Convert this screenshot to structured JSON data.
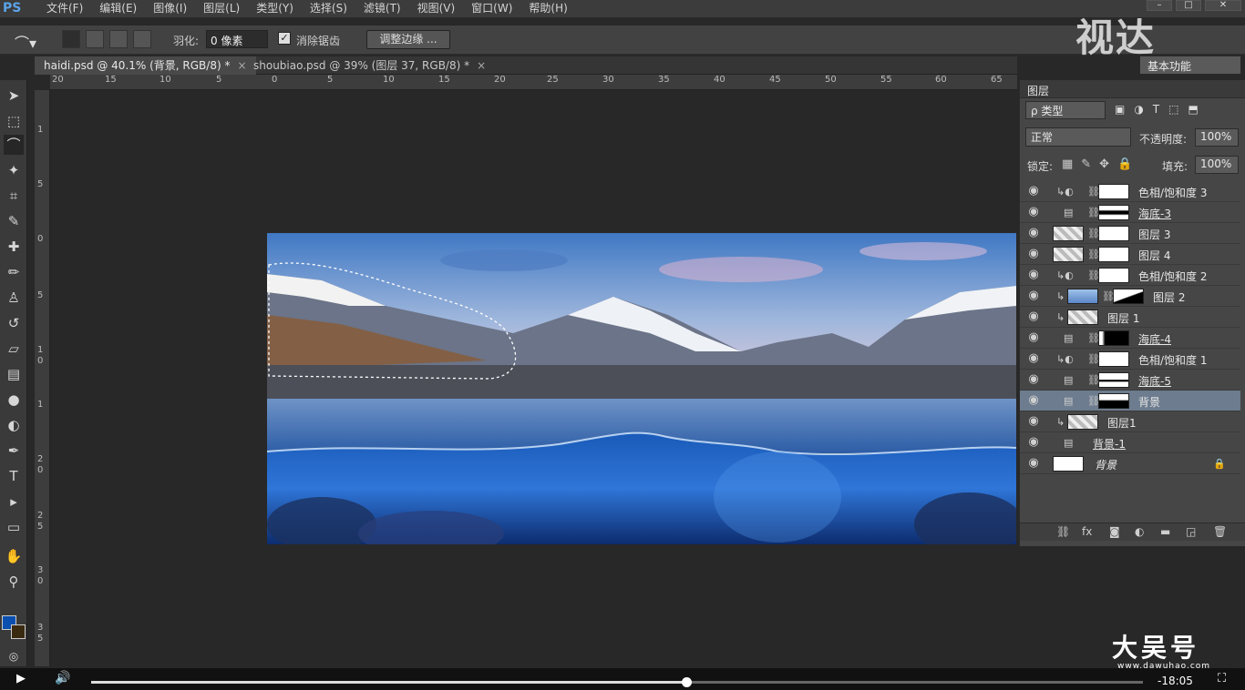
{
  "app": {
    "logo": "PS"
  },
  "menu": [
    "文件(F)",
    "编辑(E)",
    "图像(I)",
    "图层(L)",
    "类型(Y)",
    "选择(S)",
    "滤镜(T)",
    "视图(V)",
    "窗口(W)",
    "帮助(H)"
  ],
  "window_buttons": {
    "minimize": "–",
    "restore": "□",
    "close": "✕"
  },
  "options": {
    "feather_label": "羽化:",
    "feather_value": "0 像素",
    "antialias_label": "消除锯齿",
    "antialias_checked": "✓",
    "refine_edge": "调整边缘 ...",
    "workspace": "基本功能"
  },
  "watermark_top": "视达",
  "tabs": [
    {
      "label": "haidi.psd @ 40.1% (背景, RGB/8) *",
      "close": "×"
    },
    {
      "label": "shoubiao.psd @ 39% (图层 37, RGB/8) *",
      "close": "×"
    }
  ],
  "ruler_h": [
    "20",
    "15",
    "10",
    "5",
    "0",
    "5",
    "10",
    "15",
    "20",
    "25",
    "30",
    "35",
    "40",
    "45",
    "50",
    "55",
    "60",
    "65"
  ],
  "ruler_v": [
    "1",
    "5",
    "0",
    "1",
    "5",
    "1",
    "0",
    "1",
    "5",
    "2",
    "0",
    "2",
    "5",
    "3",
    "0",
    "3",
    "5"
  ],
  "layers_panel": {
    "title": "图层",
    "filter_kind": "ρ 类型",
    "blend_mode": "正常",
    "opacity_label": "不透明度:",
    "opacity_value": "100%",
    "lock_label": "锁定:",
    "fill_label": "填充:",
    "fill_value": "100%",
    "layers": [
      {
        "name": "色相/饱和度 3"
      },
      {
        "name": "海底-3"
      },
      {
        "name": "图层 3"
      },
      {
        "name": "图层 4"
      },
      {
        "name": "色相/饱和度 2"
      },
      {
        "name": "图层 2"
      },
      {
        "name": "图层 1"
      },
      {
        "name": "海底-4"
      },
      {
        "name": "色相/饱和度 1"
      },
      {
        "name": "海底-5"
      },
      {
        "name": "背景"
      },
      {
        "name": "图层1"
      },
      {
        "name": "背景-1"
      },
      {
        "name": "背景"
      }
    ]
  },
  "colors": {
    "foreground": "#0b4fb0",
    "background": "#3a2a10",
    "selected_layer": "#6d7c8e"
  },
  "video": {
    "time": "-18:05",
    "progress": 0.566
  },
  "watermark_bottom": {
    "title": "大吴号",
    "url": "www.dawuhao.com"
  }
}
